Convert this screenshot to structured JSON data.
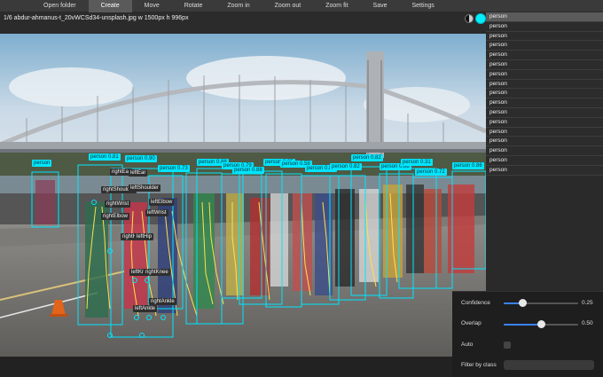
{
  "toolbar": {
    "buttons": [
      "Open folder",
      "Create",
      "Move",
      "Rotate",
      "Zoom in",
      "Zoom out",
      "Zoom fit",
      "Save",
      "Settings"
    ],
    "active": "Create"
  },
  "file": {
    "label": "1/6 abdur-ahmanus-t_20vWCSd34-unsplash.jpg w 1500px h 996px"
  },
  "accent_color": "#00e5ff",
  "detections": [
    "person",
    "person 0.81",
    "person 0.90",
    "person 0.73",
    "person 0.88",
    "person 0.79",
    "person 0.88",
    "person 0.85",
    "person 0.58",
    "person 0.86",
    "person 0.82",
    "person 0.82",
    "person 0.88",
    "person 0.31",
    "person 0.72",
    "person 0.86"
  ],
  "keypoints": [
    "rightEar",
    "leftEar",
    "rightShoulder",
    "leftShoulder",
    "rightWrist",
    "leftElbow",
    "rightElbow",
    "leftWrist",
    "rightHip",
    "leftHip",
    "leftKnee",
    "rightKnee",
    "rightAnkle",
    "leftAnkle"
  ],
  "sidebar": {
    "items": [
      "person",
      "person",
      "person",
      "person",
      "person",
      "person",
      "person",
      "person",
      "person",
      "person",
      "person",
      "person",
      "person",
      "person",
      "person",
      "person",
      "person"
    ],
    "selected_index": 0
  },
  "controls": {
    "confidence_label": "Confidence",
    "confidence_value": "0.25",
    "confidence_level": 0.25,
    "overlap_label": "Overlap",
    "overlap_value": "0.50",
    "overlap_level": 0.5,
    "auto_label": "Auto",
    "auto_checked": false,
    "filter_label": "Filter by class",
    "filter_value": ""
  }
}
